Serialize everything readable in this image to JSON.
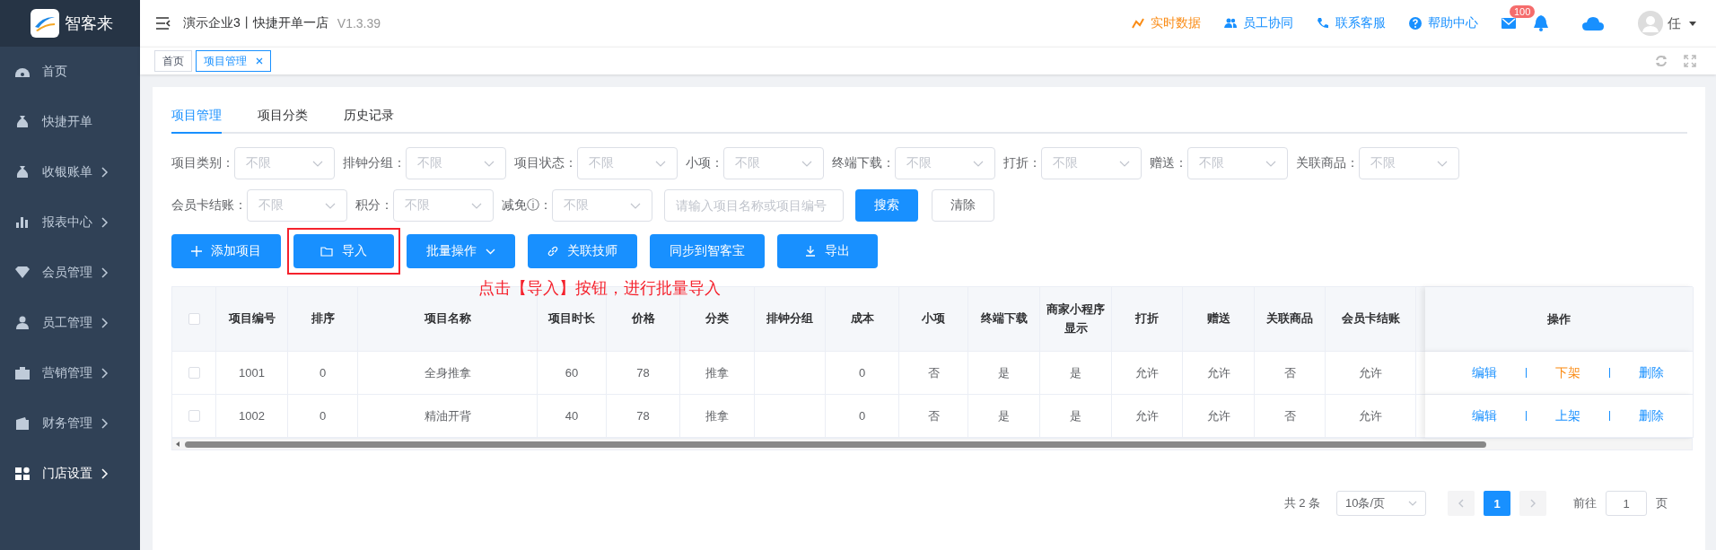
{
  "sidebar": {
    "brand": "智客来",
    "items": [
      {
        "label": "首页",
        "expandable": false,
        "selected": false
      },
      {
        "label": "快捷开单",
        "expandable": false,
        "selected": false
      },
      {
        "label": "收银账单",
        "expandable": true,
        "selected": false
      },
      {
        "label": "报表中心",
        "expandable": true,
        "selected": false
      },
      {
        "label": "会员管理",
        "expandable": true,
        "selected": false
      },
      {
        "label": "员工管理",
        "expandable": true,
        "selected": false
      },
      {
        "label": "营销管理",
        "expandable": true,
        "selected": false
      },
      {
        "label": "财务管理",
        "expandable": true,
        "selected": false
      },
      {
        "label": "门店设置",
        "expandable": true,
        "selected": true
      }
    ]
  },
  "header": {
    "title": "演示企业3丨快捷开单一店",
    "version": "V1.3.39",
    "links": [
      {
        "label": "实时数据",
        "color": "#fa8c16"
      },
      {
        "label": "员工协同",
        "color": "#1890ff"
      },
      {
        "label": "联系客服",
        "color": "#1890ff"
      },
      {
        "label": "帮助中心",
        "color": "#1890ff"
      }
    ],
    "mail_badge": "100",
    "user": "任"
  },
  "page_tabs": [
    {
      "label": "首页",
      "selected": false,
      "closable": false
    },
    {
      "label": "项目管理",
      "selected": true,
      "closable": true
    }
  ],
  "content_tabs": [
    {
      "label": "项目管理",
      "selected": true
    },
    {
      "label": "项目分类",
      "selected": false
    },
    {
      "label": "历史记录",
      "selected": false
    }
  ],
  "filters": [
    {
      "label": "项目类别：",
      "placeholder": "不限"
    },
    {
      "label": "排钟分组：",
      "placeholder": "不限"
    },
    {
      "label": "项目状态：",
      "placeholder": "不限"
    },
    {
      "label": "小项：",
      "placeholder": "不限"
    },
    {
      "label": "终端下载：",
      "placeholder": "不限"
    },
    {
      "label": "打折：",
      "placeholder": "不限"
    },
    {
      "label": "赠送：",
      "placeholder": "不限"
    },
    {
      "label": "关联商品：",
      "placeholder": "不限"
    },
    {
      "label": "会员卡结账：",
      "placeholder": "不限"
    },
    {
      "label": "积分：",
      "placeholder": "不限"
    },
    {
      "label": "减免ⓘ：",
      "placeholder": "不限"
    }
  ],
  "search": {
    "placeholder": "请输入项目名称或项目编号",
    "button": "搜索",
    "clear": "清除"
  },
  "actions": [
    {
      "label": "添加项目",
      "highlighted": false
    },
    {
      "label": "导入",
      "highlighted": true
    },
    {
      "label": "批量操作",
      "highlighted": false
    },
    {
      "label": "关联技师",
      "highlighted": false
    },
    {
      "label": "同步到智客宝",
      "highlighted": false
    },
    {
      "label": "导出",
      "highlighted": false
    }
  ],
  "annotation": "点击【导入】按钮，进行批量导入",
  "table": {
    "header_checked": false,
    "columns": [
      "项目编号",
      "排序",
      "项目名称",
      "项目时长",
      "价格",
      "分类",
      "排钟分组",
      "成本",
      "小项",
      "终端下载",
      "商家小程序显示",
      "打折",
      "赠送",
      "关联商品",
      "会员卡结账"
    ],
    "action_column": "操作",
    "rows": [
      {
        "checked": false,
        "cells": {
          "code": "1001",
          "order": "0",
          "name": "全身推拿",
          "duration": "60",
          "price": "78",
          "category": "推拿",
          "cost": "0",
          "sub": "否",
          "download": "是",
          "mini": "是",
          "discount": "允许",
          "gift": "允许",
          "goods": "否",
          "card": "允许"
        },
        "actions": [
          {
            "label": "编辑",
            "kind": "normal"
          },
          {
            "label": "下架",
            "kind": "warning"
          },
          {
            "label": "删除",
            "kind": "normal"
          }
        ]
      },
      {
        "checked": false,
        "cells": {
          "code": "1002",
          "order": "0",
          "name": "精油开背",
          "duration": "40",
          "price": "78",
          "category": "推拿",
          "cost": "0",
          "sub": "否",
          "download": "是",
          "mini": "是",
          "discount": "允许",
          "gift": "允许",
          "goods": "否",
          "card": "允许"
        },
        "actions": [
          {
            "label": "编辑",
            "kind": "normal"
          },
          {
            "label": "上架",
            "kind": "normal"
          },
          {
            "label": "删除",
            "kind": "normal"
          }
        ]
      }
    ]
  },
  "pagination": {
    "total": "共 2 条",
    "page_size": "10条/页",
    "pages": [
      {
        "label": "1",
        "selected": true
      }
    ],
    "goto_label": "前往",
    "goto_value": "1",
    "goto_suffix": "页"
  }
}
